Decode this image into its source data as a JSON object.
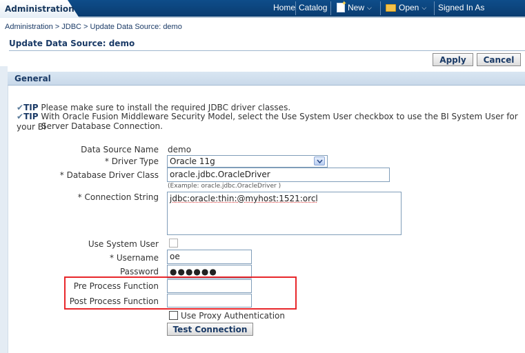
{
  "header": {
    "app_title": "Administration",
    "nav": {
      "home": "Home",
      "catalog": "Catalog",
      "new": "New",
      "open": "Open",
      "signed_in": "Signed In As"
    }
  },
  "breadcrumb": {
    "items": [
      "Administration",
      "JDBC",
      "Update Data Source: demo"
    ],
    "separator": ">"
  },
  "page": {
    "title": "Update Data Source: demo",
    "apply_label": "Apply",
    "cancel_label": "Cancel"
  },
  "section": {
    "title": "General",
    "tips": [
      {
        "label": "TIP",
        "text": "Please make sure to install the required JDBC driver classes."
      },
      {
        "label": "TIP",
        "text": "With Oracle Fusion Middleware Security Model, select the Use System User checkbox to use the BI System User for your BI",
        "text2": "Server Database Connection."
      }
    ]
  },
  "form": {
    "data_source_name": {
      "label": "Data Source Name",
      "value": "demo"
    },
    "driver_type": {
      "label": "* Driver Type",
      "value": "Oracle 11g"
    },
    "driver_class": {
      "label": "* Database Driver Class",
      "value": "oracle.jdbc.OracleDriver",
      "example": "(Example: oracle.jdbc.OracleDriver )"
    },
    "connection_string": {
      "label": "* Connection String",
      "value": "jdbc:oracle:thin:@myhost:1521:orcl"
    },
    "use_system_user": {
      "label": "Use System User",
      "checked": false
    },
    "username": {
      "label": "* Username",
      "value": "oe"
    },
    "password": {
      "label": "Password",
      "value": "●●●●●●"
    },
    "pre_process": {
      "label": "Pre Process Function",
      "value": ""
    },
    "post_process": {
      "label": "Post Process Function",
      "value": ""
    },
    "use_proxy": {
      "label": "Use Proxy Authentication",
      "checked": false
    },
    "test_connection": "Test Connection"
  },
  "colors": {
    "header_bg": "#0e4d8a",
    "link": "#1a3a66",
    "highlight": "#e8262a"
  }
}
